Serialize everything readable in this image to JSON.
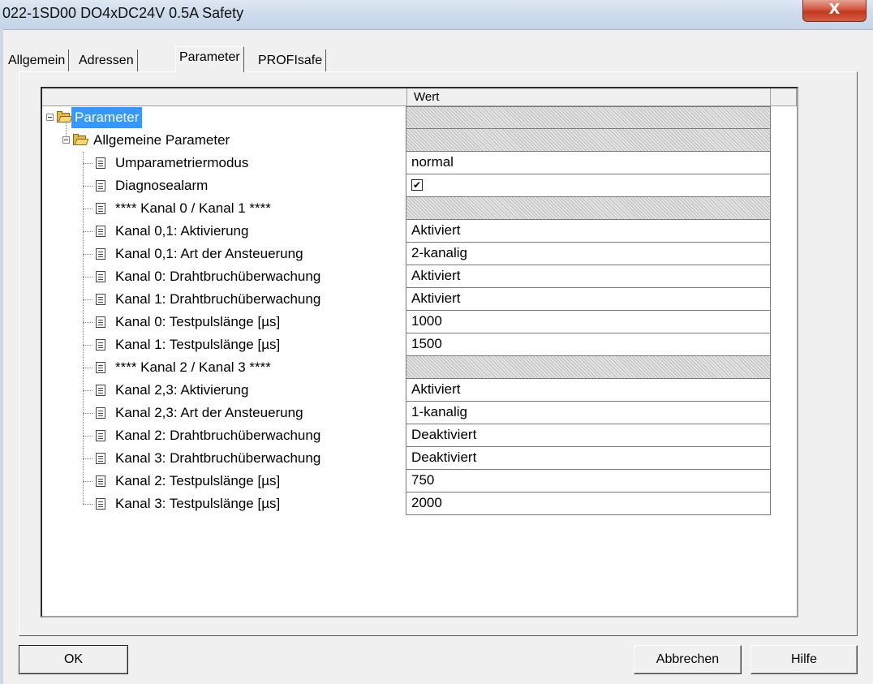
{
  "window": {
    "title": "022-1SD00 DO4xDC24V 0.5A Safety",
    "close_label": "X"
  },
  "tabs": [
    {
      "label": "Allgemein"
    },
    {
      "label": "Adressen"
    },
    {
      "label": "Parameter",
      "active": true
    },
    {
      "label": "PROFIsafe"
    }
  ],
  "grid": {
    "columns": [
      "",
      "Wert"
    ],
    "rows": [
      {
        "name": "Parameter",
        "value": "",
        "type": "folder",
        "level": 0,
        "selected": true,
        "hatched": true
      },
      {
        "name": "Allgemeine Parameter",
        "value": "",
        "type": "folder",
        "level": 1,
        "hatched": true
      },
      {
        "name": "Umparametriermodus",
        "value": "normal",
        "type": "leaf",
        "level": 2
      },
      {
        "name": "Diagnosealarm",
        "value": "✔",
        "type": "leaf",
        "level": 2,
        "checkbox": true,
        "checked": true
      },
      {
        "name": "**** Kanal 0 / Kanal 1 ****",
        "value": "",
        "type": "leaf",
        "level": 2,
        "hatched": true
      },
      {
        "name": "Kanal 0,1: Aktivierung",
        "value": "Aktiviert",
        "type": "leaf",
        "level": 2
      },
      {
        "name": "Kanal 0,1: Art der Ansteuerung",
        "value": "2-kanalig",
        "type": "leaf",
        "level": 2
      },
      {
        "name": "Kanal 0: Drahtbruchüberwachung",
        "value": "Aktiviert",
        "type": "leaf",
        "level": 2
      },
      {
        "name": "Kanal 1: Drahtbruchüberwachung",
        "value": "Aktiviert",
        "type": "leaf",
        "level": 2
      },
      {
        "name": "Kanal 0: Testpulslänge [µs]",
        "value": "1000",
        "type": "leaf",
        "level": 2
      },
      {
        "name": "Kanal 1: Testpulslänge [µs]",
        "value": "1500",
        "type": "leaf",
        "level": 2
      },
      {
        "name": "**** Kanal 2 / Kanal 3 ****",
        "value": "",
        "type": "leaf",
        "level": 2,
        "hatched": true
      },
      {
        "name": "Kanal 2,3: Aktivierung",
        "value": "Aktiviert",
        "type": "leaf",
        "level": 2
      },
      {
        "name": "Kanal 2,3: Art der Ansteuerung",
        "value": "1-kanalig",
        "type": "leaf",
        "level": 2
      },
      {
        "name": "Kanal 2: Drahtbruchüberwachung",
        "value": "Deaktiviert",
        "type": "leaf",
        "level": 2
      },
      {
        "name": "Kanal 3: Drahtbruchüberwachung",
        "value": "Deaktiviert",
        "type": "leaf",
        "level": 2
      },
      {
        "name": "Kanal 2: Testpulslänge [µs]",
        "value": "750",
        "type": "leaf",
        "level": 2
      },
      {
        "name": "Kanal 3: Testpulslänge [µs]",
        "value": "2000",
        "type": "leaf",
        "level": 2
      }
    ]
  },
  "buttons": {
    "ok": "OK",
    "cancel": "Abbrechen",
    "help": "Hilfe"
  },
  "colors": {
    "selection": "#3399ff",
    "close": "#c2391f",
    "folder": "#e5b84a"
  }
}
